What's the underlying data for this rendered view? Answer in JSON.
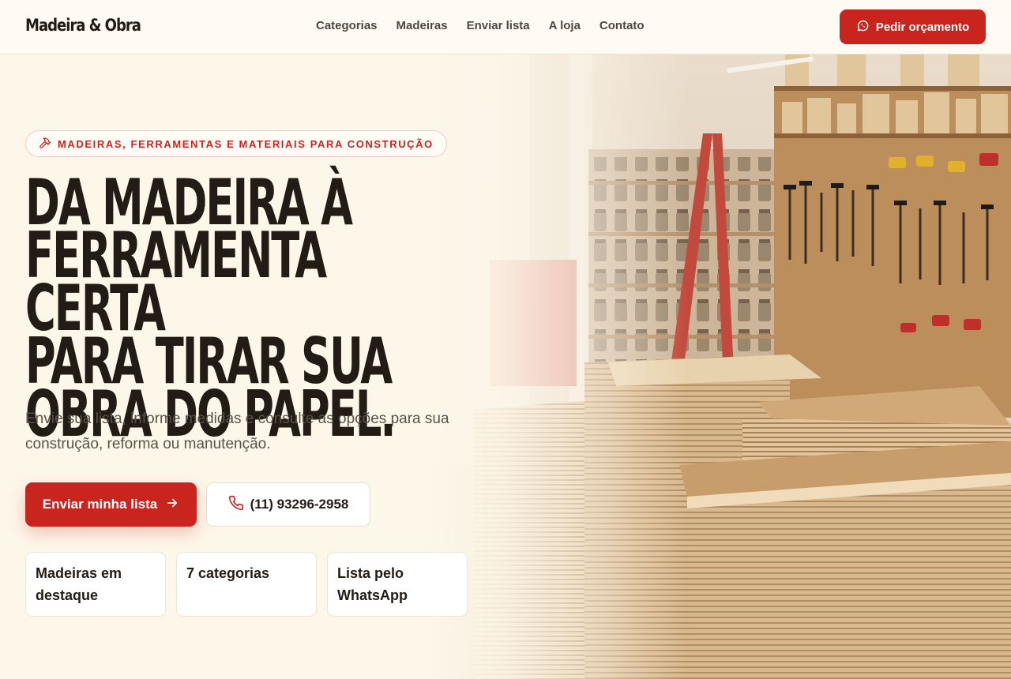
{
  "header": {
    "brand": "Madeira & Obra",
    "nav": [
      "Categorias",
      "Madeiras",
      "Enviar lista",
      "A loja",
      "Contato"
    ],
    "quote_button": "Pedir orçamento",
    "quote_icon": "whatsapp-icon"
  },
  "hero": {
    "tagline": "MADEIRAS, FERRAMENTAS E MATERIAIS PARA CONSTRUÇÃO",
    "tagline_icon": "hammer-icon",
    "headline_lines": [
      "DA MADEIRA À",
      "FERRAMENTA CERTA",
      "PARA TIRAR SUA",
      "OBRA DO PAPEL."
    ],
    "subtitle": "Envie sua lista, informe medidas e consulte as opções para sua construção, reforma ou manutenção.",
    "cta_label": "Enviar minha lista",
    "cta_icon": "arrow-right-icon",
    "phone": "(11) 93296-2958",
    "phone_icon": "phone-icon",
    "cards": [
      "Madeiras em destaque",
      "7 categorias",
      "Lista pelo WhatsApp"
    ],
    "image": "lumber-store-interior"
  },
  "colors": {
    "accent": "#c9251e",
    "background": "#fdf7ea",
    "text": "#231b16"
  }
}
